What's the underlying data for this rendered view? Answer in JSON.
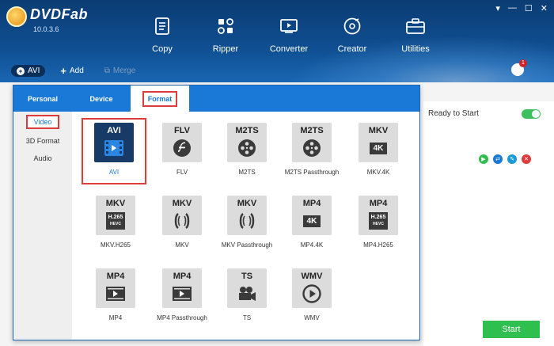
{
  "app": {
    "logo_text": "DVDFab",
    "version": "10.0.3.6"
  },
  "window_controls": [
    "▾",
    "—",
    "☐",
    "✕"
  ],
  "nav": [
    {
      "label": "Copy",
      "icon": "copy-icon"
    },
    {
      "label": "Ripper",
      "icon": "ripper-icon"
    },
    {
      "label": "Converter",
      "icon": "converter-icon"
    },
    {
      "label": "Creator",
      "icon": "creator-icon"
    },
    {
      "label": "Utilities",
      "icon": "utilities-icon"
    }
  ],
  "toolbar": {
    "profile_label": "AVI",
    "add_label": "Add",
    "merge_label": "Merge"
  },
  "task_badge": "1",
  "popup": {
    "tabs": [
      "Personal",
      "Device",
      "Format"
    ],
    "active_tab": "Format",
    "side": [
      "Video",
      "3D Format",
      "Audio"
    ],
    "active_side": "Video",
    "formats": [
      {
        "tile": "AVI",
        "label": "AVI",
        "icon": "film-icon",
        "selected": true
      },
      {
        "tile": "FLV",
        "label": "FLV",
        "icon": "flash-icon"
      },
      {
        "tile": "M2TS",
        "label": "M2TS",
        "icon": "film-reel-icon"
      },
      {
        "tile": "M2TS",
        "label": "M2TS Passthrough",
        "icon": "film-reel-icon"
      },
      {
        "tile": "MKV",
        "label": "MKV.4K",
        "icon": "4k-chip-icon",
        "chip": "4K"
      },
      {
        "tile": "MKV",
        "label": "MKV.H265",
        "icon": "h265-chip-icon",
        "chip": "H.265",
        "chip_sub": "HEVC"
      },
      {
        "tile": "MKV",
        "label": "MKV",
        "icon": "matroska-icon"
      },
      {
        "tile": "MKV",
        "label": "MKV Passthrough",
        "icon": "matroska-icon"
      },
      {
        "tile": "MP4",
        "label": "MP4.4K",
        "icon": "4k-chip-icon",
        "chip": "4K"
      },
      {
        "tile": "MP4",
        "label": "MP4.H265",
        "icon": "h265-chip-icon",
        "chip": "H.265",
        "chip_sub": "HEVC"
      },
      {
        "tile": "MP4",
        "label": "MP4",
        "icon": "play-strip-icon"
      },
      {
        "tile": "MP4",
        "label": "MP4 Passthrough",
        "icon": "play-strip-icon"
      },
      {
        "tile": "TS",
        "label": "TS",
        "icon": "camera-icon"
      },
      {
        "tile": "WMV",
        "label": "WMV",
        "icon": "play-circle-icon"
      }
    ]
  },
  "right_panel": {
    "status_text": "Ready to Start",
    "start_label": "Start"
  },
  "colors": {
    "accent": "#1a78d6",
    "highlight_box": "#e03b3b",
    "start_green": "#2fbf4f",
    "header_dark": "#0b3c73"
  }
}
